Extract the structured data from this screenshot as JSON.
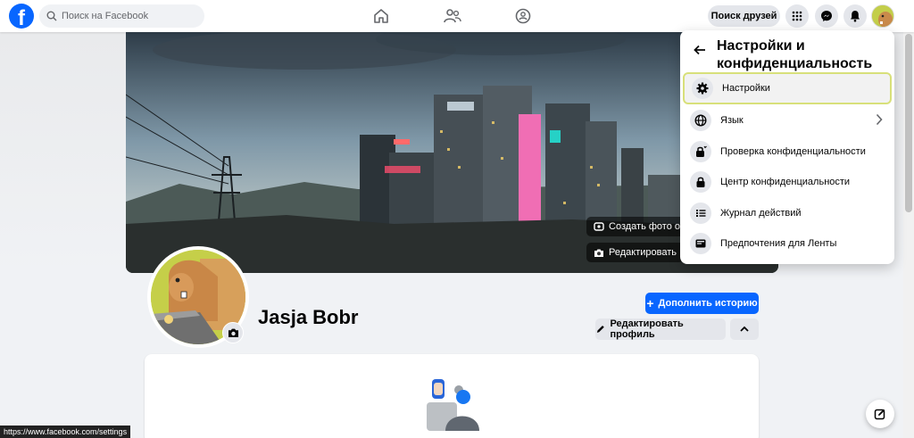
{
  "header": {
    "logo_letter": "f",
    "search_placeholder": "Поиск на Facebook",
    "find_friends_label": "Поиск друзей"
  },
  "cover": {
    "create_photo_label": "Создать фото обл",
    "edit_label": "Редактировать"
  },
  "profile": {
    "name": "Jasja Bobr",
    "add_story_label": "Дополнить историю",
    "edit_profile_label": "Редактировать профиль"
  },
  "menu": {
    "title": "Настройки и конфиденциальность",
    "items": [
      {
        "label": "Настройки",
        "icon": "gear-icon"
      },
      {
        "label": "Язык",
        "icon": "globe-icon"
      },
      {
        "label": "Проверка конфиденциальности",
        "icon": "lock-check-icon"
      },
      {
        "label": "Центр конфиденциальности",
        "icon": "lock-icon"
      },
      {
        "label": "Журнал действий",
        "icon": "list-icon"
      },
      {
        "label": "Предпочтения для Ленты",
        "icon": "feed-icon"
      }
    ]
  },
  "status_bar": {
    "url": "https://www.facebook.com/settings"
  },
  "colors": {
    "brand": "#0866ff",
    "menu_highlight_border": "#d8e07a"
  }
}
